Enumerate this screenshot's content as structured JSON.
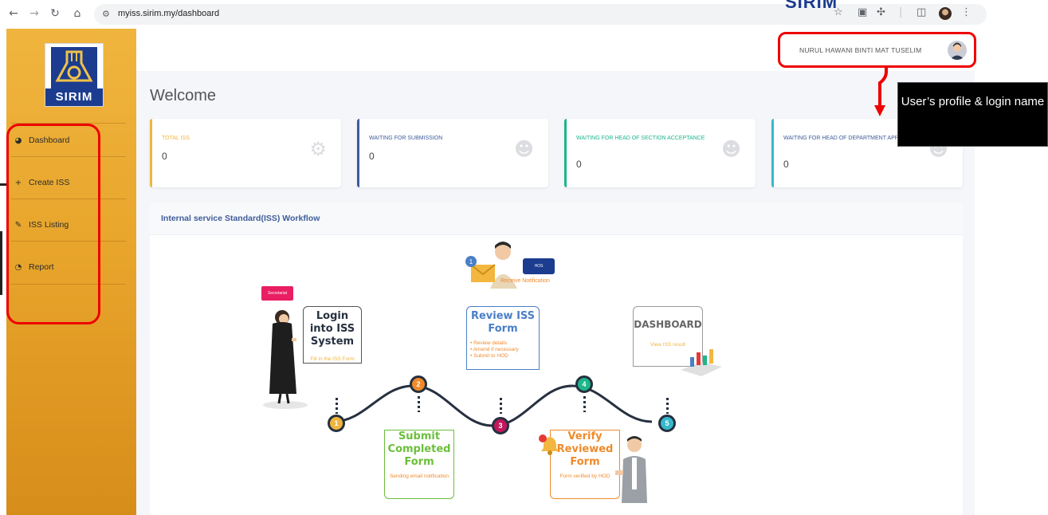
{
  "browser": {
    "url": "myiss.sirim.my/dashboard",
    "brand_peek": "SIRIM",
    "icons": [
      "back-icon",
      "forward-icon",
      "reload-icon",
      "home-icon",
      "site-settings-icon",
      "star-icon",
      "cast-icon",
      "extensions-icon",
      "sidebar-icon",
      "profile-icon",
      "menu-icon"
    ]
  },
  "sidebar": {
    "logo_text": "SIRIM",
    "items": [
      {
        "label": "Dashboard",
        "icon": "dashboard-icon"
      },
      {
        "label": "Create ISS",
        "icon": "plus-icon"
      },
      {
        "label": "ISS Listing",
        "icon": "pencil-icon"
      },
      {
        "label": "Report",
        "icon": "pie-chart-icon"
      }
    ]
  },
  "header": {
    "user_name": "NURUL HAWANI BINTI MAT TUSELIM"
  },
  "main": {
    "welcome": "Welcome",
    "cards": [
      {
        "title": "TOTAL ISS",
        "value": "0",
        "color": "#f0b53e",
        "icon": "gears-icon"
      },
      {
        "title": "WAITING FOR SUBMISSION",
        "value": "0",
        "color": "#3e5c9a",
        "icon": "user-clock-icon"
      },
      {
        "title": "WAITING FOR HEAD OF SECTION ACCEPTANCE",
        "value": "0",
        "color": "#1cb68a",
        "icon": "user-check-icon"
      },
      {
        "title": "WAITING FOR HEAD OF DEPARTMENT APPROVAL",
        "value": "0",
        "color": "#36b9cc",
        "icon": "user-tie-icon"
      }
    ],
    "workflow_title": "Internal service Standard(ISS) Workflow",
    "workflow": {
      "secretariat_tag": "Secretariat",
      "hos_tag": "HOS",
      "receive_notification": "Receive Notification",
      "stages": [
        {
          "num": "1",
          "title": "Login into ISS System",
          "subtitle": "Fill in the ISS Form"
        },
        {
          "num": "2",
          "title": "Submit Completed Form",
          "subtitle": "Sending email notification"
        },
        {
          "num": "3",
          "title": "Review ISS Form",
          "subtitle": "• Review details\n• Amend if necessary\n• Submit to HOD"
        },
        {
          "num": "4",
          "title": "Verify Reviewed Form",
          "subtitle": "Form verified by HOD"
        },
        {
          "num": "5",
          "title": "DASHBOARD",
          "subtitle": "View ISS result"
        }
      ]
    }
  },
  "annotation": {
    "text": "User’s profile & login name"
  },
  "colors": {
    "sidebar": "#e8a52c",
    "highlight": "#ee0000",
    "stage1": "#263040",
    "stage2": "#6bbf3a",
    "stage3": "#4a7fc8",
    "stage4": "#f08a2a",
    "stage5": "#9a9a9a"
  }
}
